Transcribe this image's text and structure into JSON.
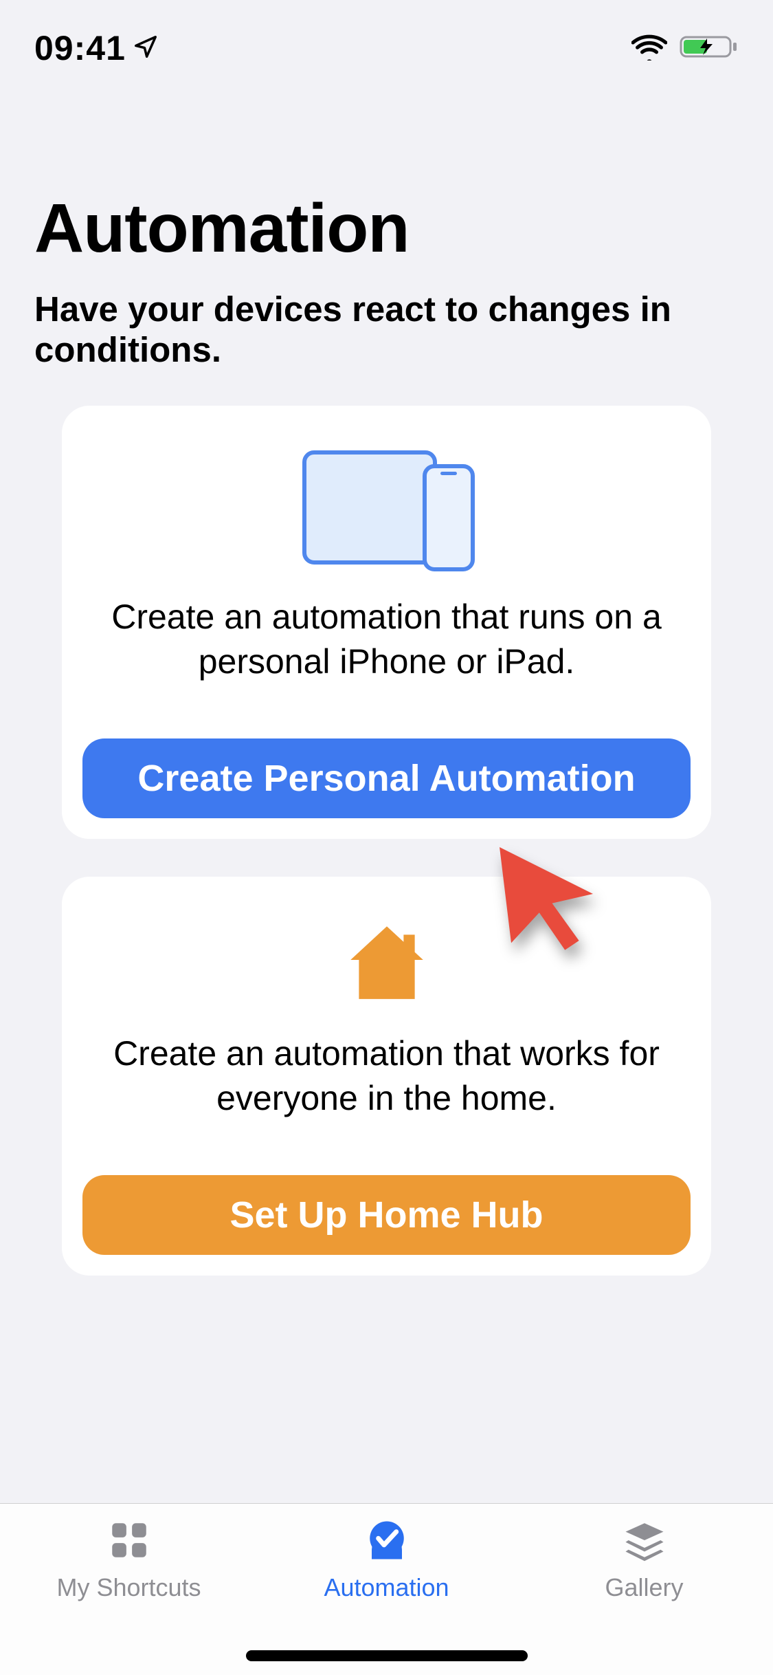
{
  "status": {
    "time": "09:41",
    "colors": {
      "battery_fill": "#41c954"
    }
  },
  "header": {
    "title": "Automation",
    "subtitle": "Have your devices react to changes in conditions."
  },
  "cards": {
    "personal": {
      "description": "Create an automation that runs on a personal iPhone or iPad.",
      "button_label": "Create Personal Automation",
      "accent": "#3e79ef"
    },
    "home": {
      "description": "Create an automation that works for everyone in the home.",
      "button_label": "Set Up Home Hub",
      "accent": "#ed9a34"
    }
  },
  "tabs": {
    "shortcuts": {
      "label": "My Shortcuts"
    },
    "automation": {
      "label": "Automation"
    },
    "gallery": {
      "label": "Gallery"
    }
  }
}
